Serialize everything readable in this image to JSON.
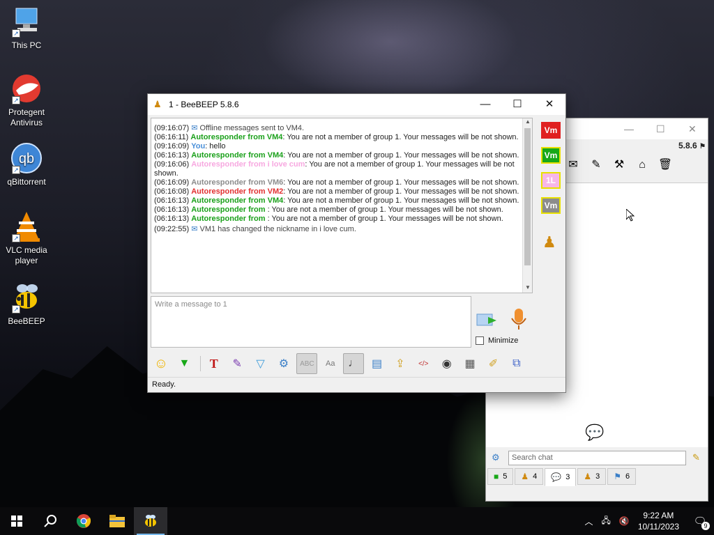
{
  "desktop": {
    "icons": [
      {
        "label": "This PC",
        "icon": "computer-icon"
      },
      {
        "label": "Protegent Antivirus",
        "icon": "protegent-icon"
      },
      {
        "label": "qBittorrent",
        "icon": "qbittorrent-icon"
      },
      {
        "label": "VLC media player",
        "icon": "vlc-icon"
      },
      {
        "label": "BeeBEEP",
        "icon": "bee-icon"
      }
    ]
  },
  "main_window": {
    "title": "1 - BeeBEEP 5.8.6",
    "status": "Ready.",
    "input_placeholder": "Write a message to 1",
    "minimize_label": "Minimize",
    "messages": [
      {
        "time": "(09:16:07)",
        "sender": "",
        "sender_color": "",
        "text": "Offline messages sent to VM4.",
        "system": true
      },
      {
        "time": "(06:16:11)",
        "sender": "Autoresponder from VM4",
        "sender_color": "#1aa01a",
        "text": ": You are not a member of group 1. Your messages will be not shown."
      },
      {
        "time": "(09:16:09)",
        "sender": "You",
        "sender_color": "#4a90d9",
        "text": ": hello"
      },
      {
        "time": "(06:16:13)",
        "sender": "Autoresponder from VM4",
        "sender_color": "#1aa01a",
        "text": ": You are not a member of group 1. Your messages will be not shown."
      },
      {
        "time": "(09:16:06)",
        "sender": "Autoresponder from i love cum",
        "sender_color": "#f7a8e0",
        "text": ": You are not a member of group 1. Your messages will be not shown."
      },
      {
        "time": "(06:16:09)",
        "sender": "Autoresponder from VM6",
        "sender_color": "#8c8c8c",
        "text": ": You are not a member of group 1. Your messages will be not shown."
      },
      {
        "time": "(06:16:08)",
        "sender": "Autoresponder from VM2",
        "sender_color": "#e23030",
        "text": ": You are not a member of group 1. Your messages will be not shown."
      },
      {
        "time": "(06:16:13)",
        "sender": "Autoresponder from VM4",
        "sender_color": "#1aa01a",
        "text": ": You are not a member of group 1. Your messages will be not shown."
      },
      {
        "time": "(06:16:13)",
        "sender": "Autoresponder from ",
        "sender_color": "#1aa01a",
        "text": ": You are not a member of group 1. Your messages will be not shown."
      },
      {
        "time": "(06:16:13)",
        "sender": "Autoresponder from ",
        "sender_color": "#1aa01a",
        "text": ": You are not a member of group 1. Your messages will be not shown."
      },
      {
        "time": "(09:22:55)",
        "sender": "",
        "sender_color": "",
        "text": "VM1 has changed the nickname in i love cum.",
        "system": true
      }
    ],
    "members": [
      {
        "label": "Vm",
        "bg": "#e02020",
        "border": "#e02020"
      },
      {
        "label": "Vm",
        "bg": "#18a818",
        "border": "#e8e000"
      },
      {
        "label": "1L",
        "bg": "#f7b6e8",
        "border": "#e8e000"
      },
      {
        "label": "Vm",
        "bg": "#8c8c8c",
        "border": "#e8e000"
      }
    ],
    "toolbar_icons": [
      "emoticon-icon",
      "download-icon",
      "text-format-icon",
      "color-pen-icon",
      "filter-icon",
      "gear-icon",
      "spellcheck-icon",
      "font-icon",
      "music-note-icon",
      "save-chat-icon",
      "share-file-icon",
      "html-code-icon",
      "screenshot-icon",
      "clear-icon",
      "edit-note-icon",
      "dock-window-icon"
    ]
  },
  "secondary_window": {
    "version": "5.8.6",
    "search_placeholder": "Search chat",
    "tabs": [
      {
        "icon": "users-icon",
        "count": "5"
      },
      {
        "icon": "groups-icon",
        "count": "4"
      },
      {
        "icon": "chat-icon",
        "count": "3"
      },
      {
        "icon": "group-chat-icon",
        "count": "3"
      },
      {
        "icon": "history-icon",
        "count": "6"
      }
    ]
  },
  "taskbar": {
    "time": "9:22 AM",
    "date": "10/11/2023",
    "notification_count": "9"
  }
}
